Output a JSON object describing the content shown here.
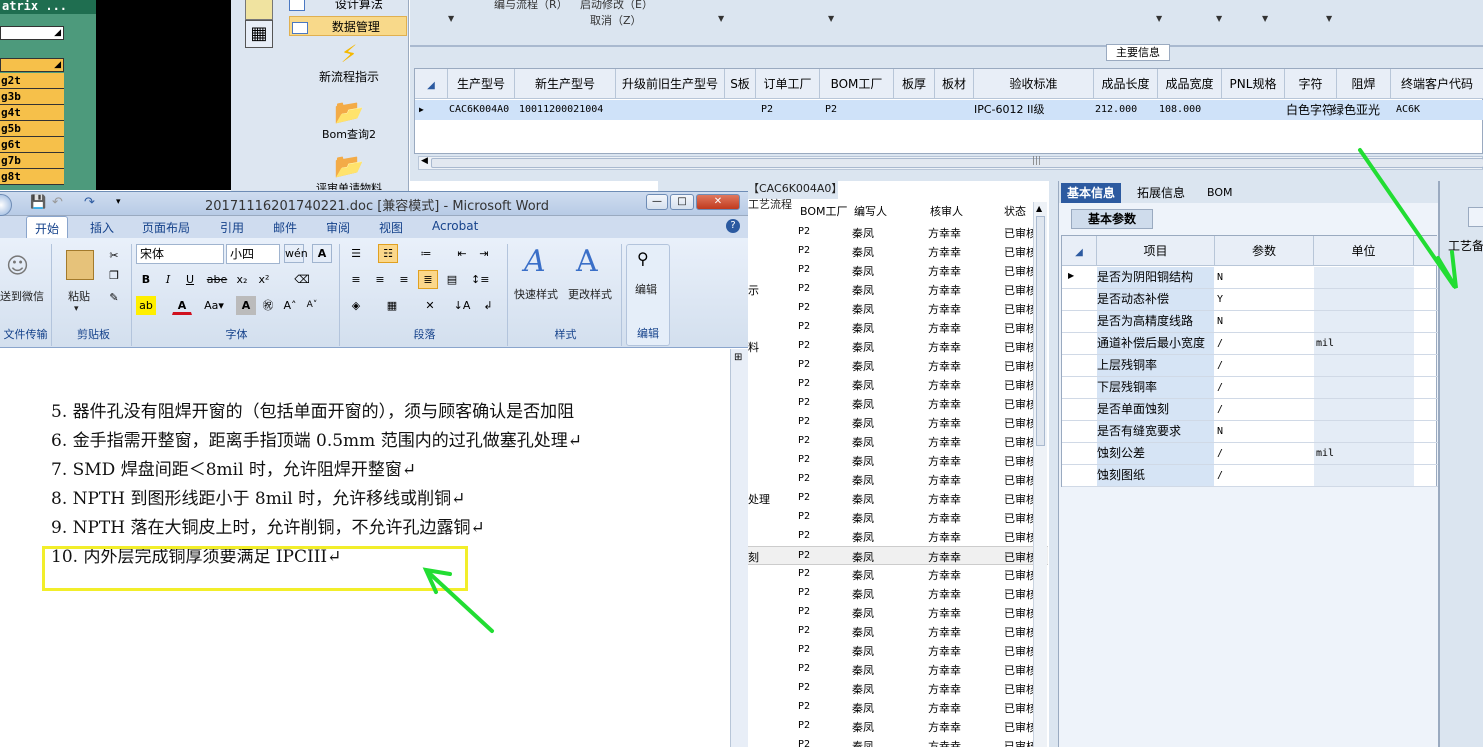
{
  "matrix": {
    "title": "atrix ...",
    "items": [
      "g2t",
      "g3b",
      "g4t",
      "g5b",
      "g6t",
      "g7b",
      "g8t"
    ]
  },
  "nav": {
    "item1": "设计算法",
    "item2": "数据管理",
    "flow": "新流程指示",
    "bom": "Bom查询2",
    "partial": "评审单请物料"
  },
  "topstrip": {
    "flow_label": "编与流程（R）",
    "start_label": "启动修改（E）",
    "cancel_label": "取消（Z）"
  },
  "main_info": {
    "tag": "主要信息",
    "columns": [
      "生产型号",
      "新生产型号",
      "升级前旧生产型号",
      "S板",
      "订单工厂",
      "BOM工厂",
      "板厚",
      "板材",
      "验收标准",
      "成品长度",
      "成品宽度",
      "PNL规格",
      "字符",
      "阻焊",
      "终端客户代码"
    ],
    "row": {
      "model": "CAC6K004A0",
      "new_model": "10011200021004",
      "order_factory": "P2",
      "bom_factory": "P2",
      "standard": "IPC-6012 II级",
      "length": "212.000",
      "width": "108.000",
      "char": "白色字符",
      "mask": "绿色亚光",
      "customer": "AC6K"
    }
  },
  "process": {
    "tab": "【CAC6K004A0】工艺流程",
    "columns": [
      "BOM工厂",
      "编写人",
      "核审人",
      "状态"
    ],
    "side_labels": [
      "示",
      "料",
      "处理",
      "刻"
    ],
    "factory": "P2",
    "author": "秦凤",
    "reviewer": "方幸幸",
    "status": "已审核",
    "row_count": 28
  },
  "right_panel": {
    "tabs": [
      "基本信息",
      "拓展信息",
      "BOM"
    ],
    "subtab": "基本参数",
    "columns": [
      "项目",
      "参数",
      "单位"
    ],
    "rows": [
      {
        "item": "是否为阴阳铜结构",
        "param": "N",
        "unit": ""
      },
      {
        "item": "是否动态补偿",
        "param": "Y",
        "unit": ""
      },
      {
        "item": "是否为高精度线路",
        "param": "N",
        "unit": ""
      },
      {
        "item": "通道补偿后最小宽度",
        "param": "/",
        "unit": "mil"
      },
      {
        "item": "上层残铜率",
        "param": "/",
        "unit": ""
      },
      {
        "item": "下层残铜率",
        "param": "/",
        "unit": ""
      },
      {
        "item": "是否单面蚀刻",
        "param": "/",
        "unit": ""
      },
      {
        "item": "是否有缝宽要求",
        "param": "N",
        "unit": ""
      },
      {
        "item": "蚀刻公差",
        "param": "/",
        "unit": "mil"
      },
      {
        "item": "蚀刻图纸",
        "param": "/",
        "unit": ""
      }
    ],
    "far_right": "工艺备"
  },
  "word": {
    "title": "20171116201740221.doc [兼容模式] - Microsoft Word",
    "tabs": [
      "开始",
      "插入",
      "页面布局",
      "引用",
      "邮件",
      "审阅",
      "视图",
      "Acrobat"
    ],
    "groups": {
      "wechat": "送到微信",
      "wechat_group": "文件传输",
      "clipboard": "剪贴板",
      "paste": "粘贴",
      "font": "字体",
      "paragraph": "段落",
      "styles": "样式",
      "quick_style": "快速样式",
      "change_style": "更改样式",
      "edit": "编辑",
      "editing": "编辑"
    },
    "font_name": "宋体",
    "font_size": "小四",
    "lines": [
      "5.  器件孔没有阻焊开窗的（包括单面开窗的），须与顾客确认是否加阻",
      "6.  金手指需开整窗，距离手指顶端 0.5mm 范围内的过孔做塞孔处理↵",
      "7.  SMD 焊盘间距＜8mil 时，允许阻焊开整窗↵",
      "8.  NPTH 到图形线距小于 8mil 时，允许移线或削铜↵",
      "9.  NPTH 落在大铜皮上时，允许削铜，不允许孔边露铜↵",
      "10. 内外层完成铜厚须要满足 IPCIII↵"
    ]
  },
  "colors": {
    "highlight": "#f2ee2a",
    "arrow": "#22dd33",
    "active_tab": "#2c5aa0"
  }
}
